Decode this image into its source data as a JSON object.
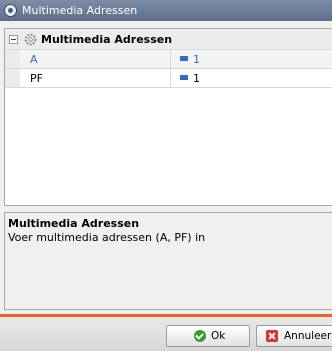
{
  "window": {
    "title": "Multimedia Adressen"
  },
  "grid": {
    "category": "Multimedia Adressen",
    "rows": [
      {
        "name": "A",
        "value": "1"
      },
      {
        "name": "PF",
        "value": "1"
      }
    ]
  },
  "description": {
    "title": "Multimedia Adressen",
    "text": "Voer multimedia adressen (A, PF) in"
  },
  "buttons": {
    "ok": "Ok",
    "cancel": "Annuleer"
  },
  "icons": [
    "app-icon",
    "collapse-icon",
    "gear-icon",
    "property-icon",
    "ok-check-icon",
    "cancel-x-icon"
  ],
  "colors": {
    "accent": "#e8632a",
    "link": "#2c6fbf",
    "titlebar": "#6a7b96"
  }
}
